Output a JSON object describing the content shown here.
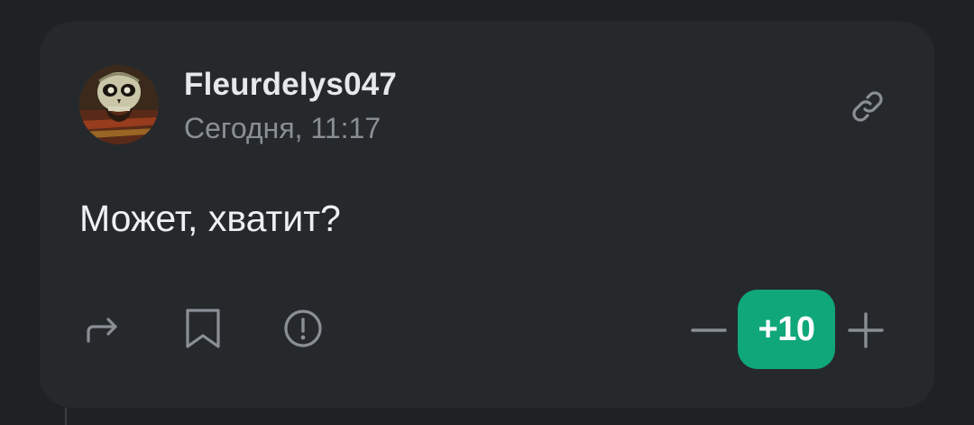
{
  "comment": {
    "author": "Fleurdelys047",
    "timestamp": "Сегодня, 11:17",
    "text": "Может, хватит?",
    "rating": "+10"
  },
  "icons": {
    "avatar": "skull-avatar-image",
    "link": "link-icon",
    "share": "share-arrow-icon",
    "bookmark": "bookmark-icon",
    "report": "exclamation-circle-icon",
    "downvote": "minus-icon",
    "upvote": "plus-icon"
  },
  "colors": {
    "background": "#1f2123",
    "card": "#26292c",
    "accent": "#10a77a",
    "text_primary": "#eef0f2",
    "text_secondary": "#8a8f95",
    "icon": "#8a8f95"
  }
}
